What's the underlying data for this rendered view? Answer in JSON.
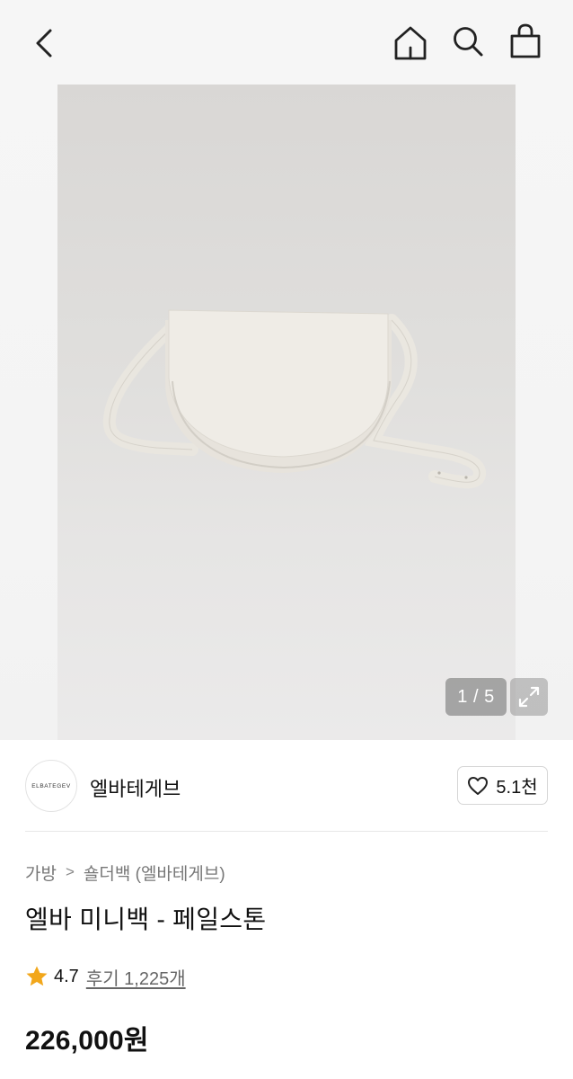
{
  "header": {
    "icons": {
      "back": "chevron-left-icon",
      "home": "home-icon",
      "search": "search-icon",
      "cart": "shopping-bag-icon"
    }
  },
  "gallery": {
    "page_counter": "1 / 5",
    "current_page": 1,
    "total_pages": 5
  },
  "brand": {
    "logo_text": "ELBATEGEV",
    "name": "엘바테게브",
    "like_count": "5.1천"
  },
  "breadcrumb": {
    "items": [
      "가방",
      "숄더백 (엘바테게브)"
    ],
    "separator": ">"
  },
  "product": {
    "title": "엘바 미니백 - 페일스톤",
    "rating": "4.7",
    "review_link": "후기 1,225개",
    "price": "226,000원"
  },
  "colors": {
    "star": "#f2a71b",
    "text": "#111111",
    "muted": "#777777"
  }
}
